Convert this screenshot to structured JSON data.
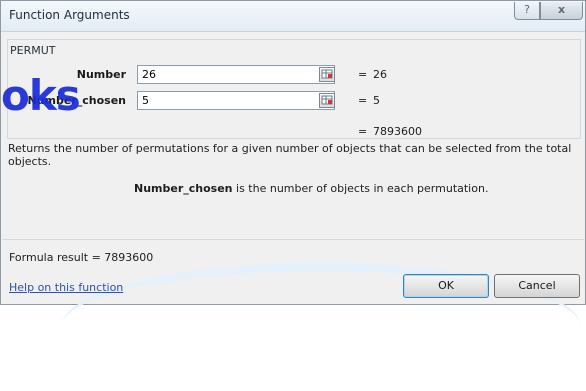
{
  "window": {
    "title": "Function Arguments",
    "help_glyph": "?",
    "close_glyph": "x"
  },
  "function": {
    "name": "PERMUT"
  },
  "arguments": [
    {
      "label": "Number",
      "value": "26",
      "equals": "=",
      "result": "26"
    },
    {
      "label": "Number_chosen",
      "value": "5",
      "equals": "=",
      "result": "5"
    }
  ],
  "overall": {
    "equals": "=",
    "result": "7893600"
  },
  "description": "Returns the number of permutations for a given number of objects that can be selected from the total objects.",
  "arg_help": {
    "name": "Number_chosen",
    "text": "is the number of objects in each permutation."
  },
  "formula_result": "Formula result =  7893600",
  "help_link": "Help on this function",
  "buttons": {
    "ok": "OK",
    "cancel": "Cancel"
  },
  "watermark": "oks",
  "colors": {
    "watermark": "#1a2bd8",
    "link": "#2a50b3",
    "title_bar": "#e3ebf3"
  },
  "icons": {
    "ref": "collapse-dialog-icon",
    "help": "help-icon",
    "close": "close-icon"
  }
}
